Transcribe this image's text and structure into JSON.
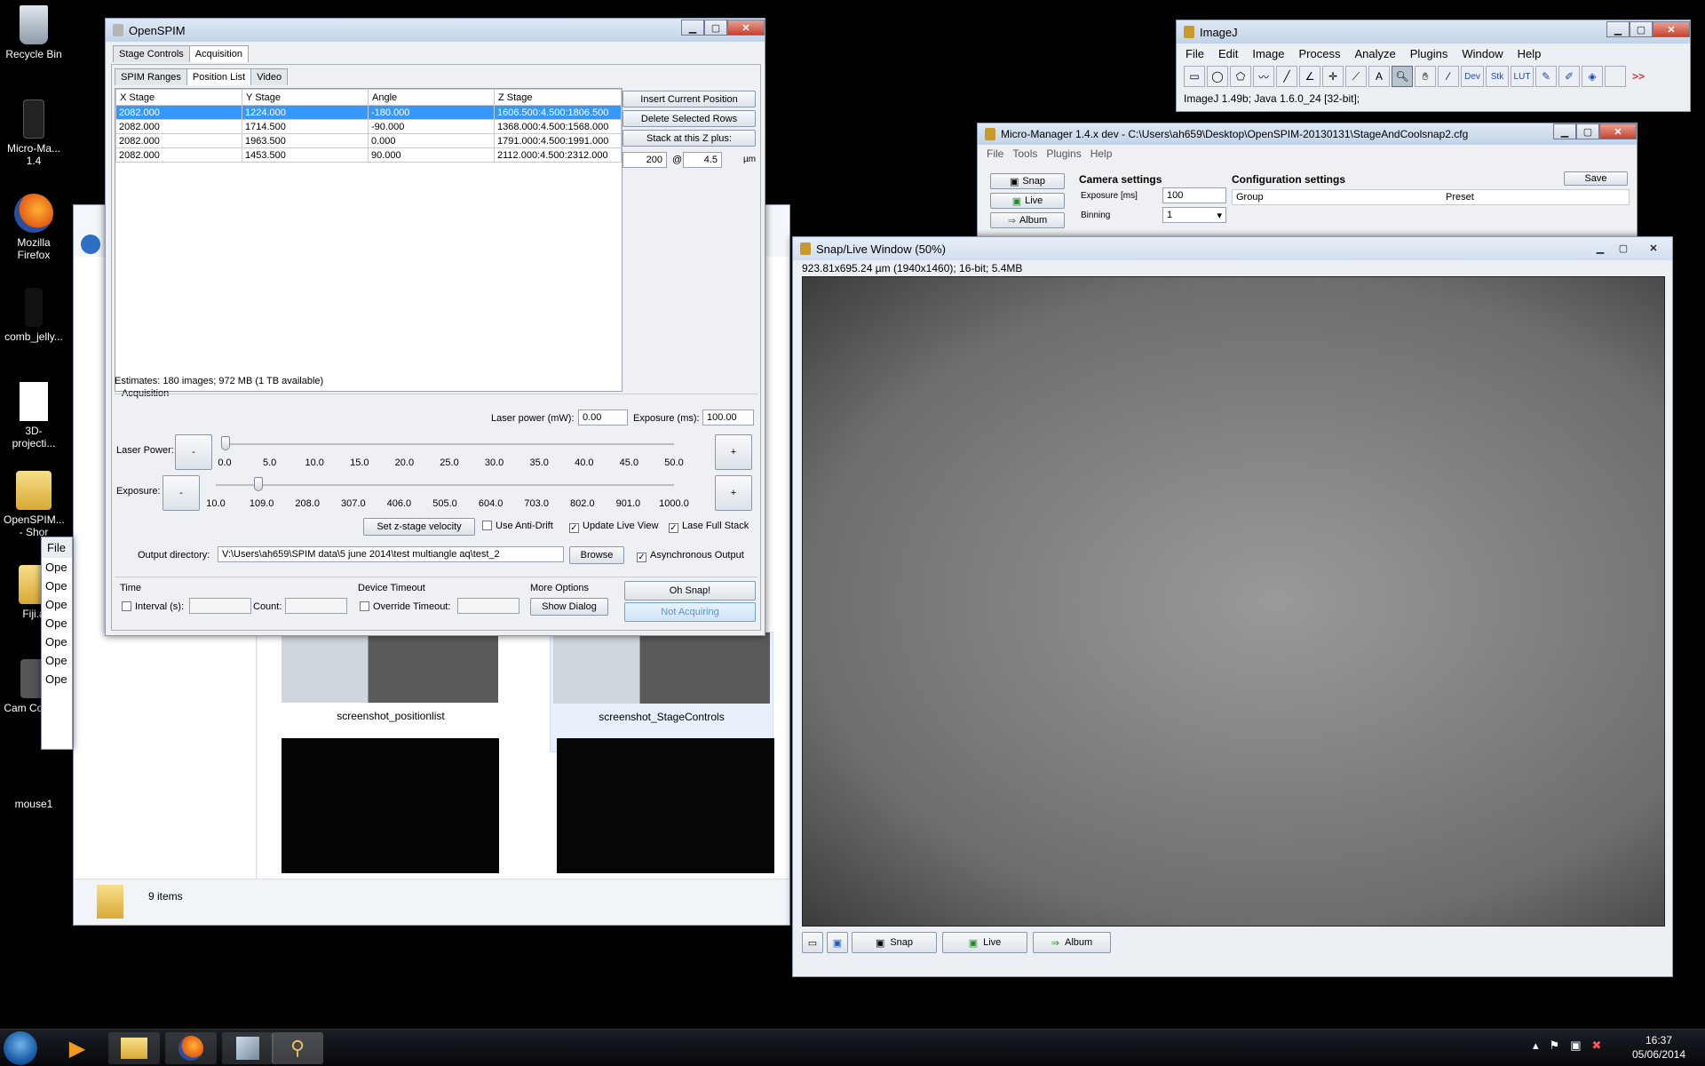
{
  "desktop": {
    "icons": [
      {
        "label": "Recycle Bin"
      },
      {
        "label": "Micro-Ma... 1.4"
      },
      {
        "label": "Mozilla Firefox"
      },
      {
        "label": "comb_jelly..."
      },
      {
        "label": "3D-projecti..."
      },
      {
        "label": "OpenSPIM... - Shor"
      },
      {
        "label": "Fiji.a"
      },
      {
        "label": "Cam Control"
      },
      {
        "label": "mouse1"
      }
    ]
  },
  "explorer": {
    "thumbs": [
      {
        "label": "screenshot_positionlist"
      },
      {
        "label": "screenshot_StageControls"
      }
    ],
    "status": "9 items",
    "side_menu_label": "File",
    "side_list": [
      "Ope",
      "Ope",
      "Ope",
      "Ope",
      "Ope",
      "Ope",
      "Ope"
    ]
  },
  "openspim": {
    "title": "OpenSPIM",
    "tabs": [
      "Stage Controls",
      "Acquisition"
    ],
    "subtabs": [
      "SPIM Ranges",
      "Position List",
      "Video"
    ],
    "columns": [
      "X Stage",
      "Y Stage",
      "Angle",
      "Z Stage"
    ],
    "rows": [
      [
        "2082.000",
        "1224.000",
        "-180.000",
        "1606.500:4.500:1806.500"
      ],
      [
        "2082.000",
        "1714.500",
        "-90.000",
        "1368.000:4.500:1568.000"
      ],
      [
        "2082.000",
        "1963.500",
        "0.000",
        "1791.000:4.500:1991.000"
      ],
      [
        "2082.000",
        "1453.500",
        "90.000",
        "2112.000:4.500:2312.000"
      ]
    ],
    "buttons": {
      "insert": "Insert Current Position",
      "delete": "Delete Selected Rows",
      "stack": "Stack at this Z plus:"
    },
    "stack_count": "200",
    "stack_at": "@",
    "stack_step": "4.5",
    "stack_unit": "µm",
    "estimates": "Estimates: 180 images; 972 MB (1 TB available)",
    "acq_title": "Acquisition",
    "laser_power_label": "Laser power (mW):",
    "laser_power": "0.00",
    "exposure_label": "Exposure (ms):",
    "exposure": "100.00",
    "laser_slider_label": "Laser Power:",
    "laser_ticks": [
      "0.0",
      "5.0",
      "10.0",
      "15.0",
      "20.0",
      "25.0",
      "30.0",
      "35.0",
      "40.0",
      "45.0",
      "50.0"
    ],
    "laser_level": 0.0,
    "exposure_slider_label": "Exposure:",
    "exposure_ticks": [
      "10.0",
      "109.0",
      "208.0",
      "307.0",
      "406.0",
      "505.0",
      "604.0",
      "703.0",
      "802.0",
      "901.0",
      "1000.0"
    ],
    "exposure_level": 0.091,
    "minus": "-",
    "plus": "+",
    "zvel_button": "Set z-stage velocity",
    "anti_drift": "Use Anti-Drift",
    "update_live": "Update Live View",
    "lase_full": "Lase Full Stack",
    "output_label": "Output directory:",
    "output_dir": "V:\\Users\\ah659\\SPIM data\\5 june 2014\\test multiangle aq\\test_2",
    "browse": "Browse",
    "async": "Asynchronous Output",
    "time_title": "Time",
    "interval": "Interval (s):",
    "count": "Count:",
    "device_timeout": "Device Timeout",
    "override": "Override Timeout:",
    "more_options": "More Options",
    "show_dialog": "Show Dialog",
    "oh_snap": "Oh Snap!",
    "not_acquiring": "Not Acquiring"
  },
  "imagej": {
    "title": "ImageJ",
    "menu": [
      "File",
      "Edit",
      "Image",
      "Process",
      "Analyze",
      "Plugins",
      "Window",
      "Help"
    ],
    "tools": [
      "Dev",
      "Stk",
      "LUT"
    ],
    "more": ">>",
    "status": "ImageJ 1.49b; Java 1.6.0_24 [32-bit];"
  },
  "micromanager": {
    "title": "Micro-Manager 1.4.x dev - C:\\Users\\ah659\\Desktop\\OpenSPIM-20130131\\StageAndCoolsnap2.cfg",
    "menu": [
      "File",
      "Tools",
      "Plugins",
      "Help"
    ],
    "buttons": [
      "Snap",
      "Live",
      "Album"
    ],
    "camera_settings": "Camera settings",
    "exposure_label": "Exposure [ms]",
    "exposure": "100",
    "binning_label": "Binning",
    "binning": "1",
    "config_settings": "Configuration settings",
    "save": "Save",
    "group": "Group",
    "preset": "Preset"
  },
  "snaplive": {
    "title": "Snap/Live Window (50%)",
    "info": "923.81x695.24 µm (1940x1460); 16-bit; 5.4MB",
    "buttons": [
      "Snap",
      "Live",
      "Album"
    ]
  },
  "taskbar": {
    "time": "16:37",
    "date": "05/06/2014"
  }
}
